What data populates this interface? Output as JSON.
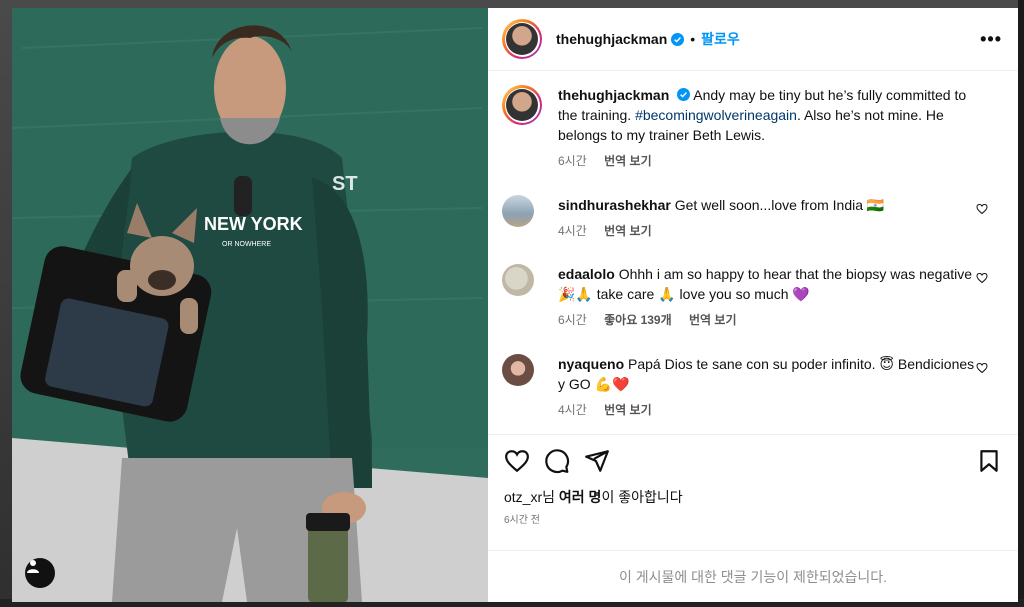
{
  "post": {
    "username": "thehughjackman",
    "follow_label": "팔로우",
    "dot": "•",
    "more": "•••"
  },
  "caption": {
    "username": "thehughjackman",
    "text_before": "Andy may be tiny but he’s fully committed to the training. ",
    "hashtag": "#becomingwolverineagain",
    "text_after": ". Also he’s not mine. He belongs to my trainer Beth Lewis.",
    "time": "6시간",
    "translate": "번역 보기"
  },
  "comments": [
    {
      "username": "sindhurashekhar",
      "text": "Get well soon...love from India 🇮🇳",
      "flag_text": "IN",
      "time": "4시간",
      "translate": "번역 보기"
    },
    {
      "username": "edaalolo",
      "text": "Ohhh i am so happy to hear that the biopsy was negative 🎉🙏 take care 🙏 love you so much 💜",
      "time": "6시간",
      "likes": "좋아요 139개",
      "translate": "번역 보기"
    },
    {
      "username": "nyaqueno",
      "text": "Papá Dios te sane con su poder infinito. 😇 Bendiciones y GO 💪❤️",
      "time": "4시간",
      "translate": "번역 보기"
    }
  ],
  "likes": {
    "user": "otz_xr",
    "suffix_1": "님 ",
    "others": "여러 명",
    "suffix_2": "이 좋아합니다"
  },
  "time_ago": "6시간 전",
  "comments_disabled": "이 게시물에 대한 댓글 기능이 제한되었습니다.",
  "colors": {
    "accent": "#0095f6",
    "verified": "#0095f6",
    "wall": "#2f6c5c"
  },
  "icons": [
    "user-tag-icon",
    "heart-icon",
    "comment-icon",
    "share-icon",
    "bookmark-icon",
    "verified-icon",
    "more-icon"
  ]
}
